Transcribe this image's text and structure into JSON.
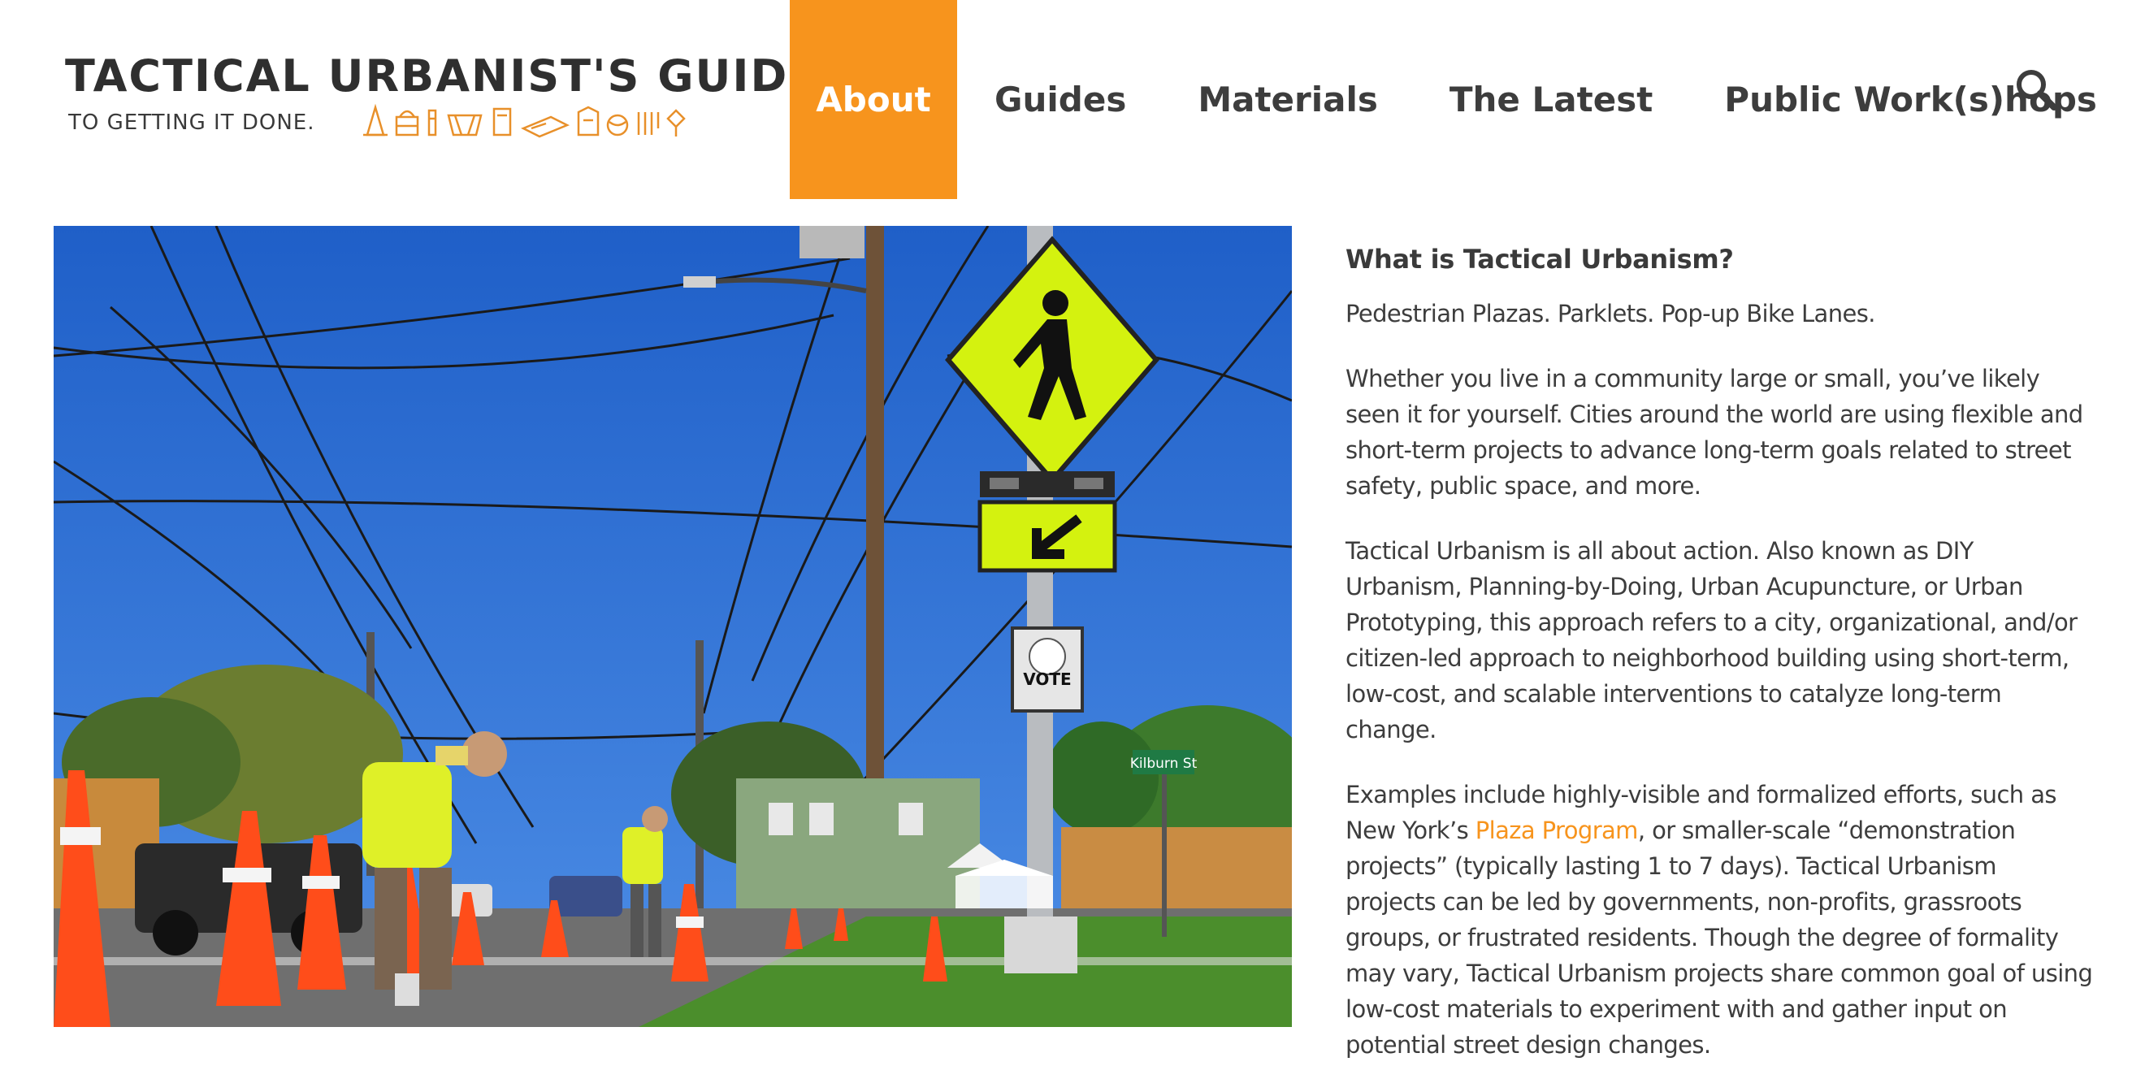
{
  "header": {
    "logo_title": "TACTICAL URBANIST'S GUIDE",
    "logo_subtitle": "TO GETTING IT DONE.",
    "nav": [
      {
        "label": "About",
        "active": true
      },
      {
        "label": "Guides",
        "active": false
      },
      {
        "label": "Materials",
        "active": false
      },
      {
        "label": "The Latest",
        "active": false
      },
      {
        "label": "Public Work(s)hops",
        "active": false
      }
    ],
    "search_icon": "search-icon"
  },
  "hero": {
    "street_sign": "Kilburn St",
    "poster_text": "VOTE"
  },
  "article": {
    "heading": "What is Tactical Urbanism?",
    "tagline": "Pedestrian Plazas. Parklets. Pop-up Bike Lanes.",
    "p1": "Whether you live in a community large or small, you’ve likely seen it for yourself. Cities around the world are using flexible and short-term projects to advance long-term goals related to street safety, public space, and more.",
    "p2": "Tactical Urbanism is all about action. Also known as DIY Urbanism, Planning-by-Doing, Urban Acupuncture, or Urban Prototyping, this approach refers to a city, organizational, and/or citizen-led approach to neighborhood building using short-term, low-cost, and scalable interventions to catalyze long-term change.",
    "p3_before": "Examples include highly-visible and formalized efforts, such as New York’s ",
    "p3_link": "Plaza Program",
    "p3_after": ", or smaller-scale “demonstration projects” (typically lasting 1 to 7 days). Tactical Urbanism projects can be led by governments, non-profits, grassroots groups, or frustrated residents. Though the degree of formality may vary, Tactical Urbanism projects share common goal of using low-cost materials to experiment with and gather input on potential street design changes."
  },
  "colors": {
    "accent": "#f7941d",
    "text": "#3d3d3d",
    "sky": "#2f6fd0",
    "sign_yellow": "#d4f20f"
  }
}
